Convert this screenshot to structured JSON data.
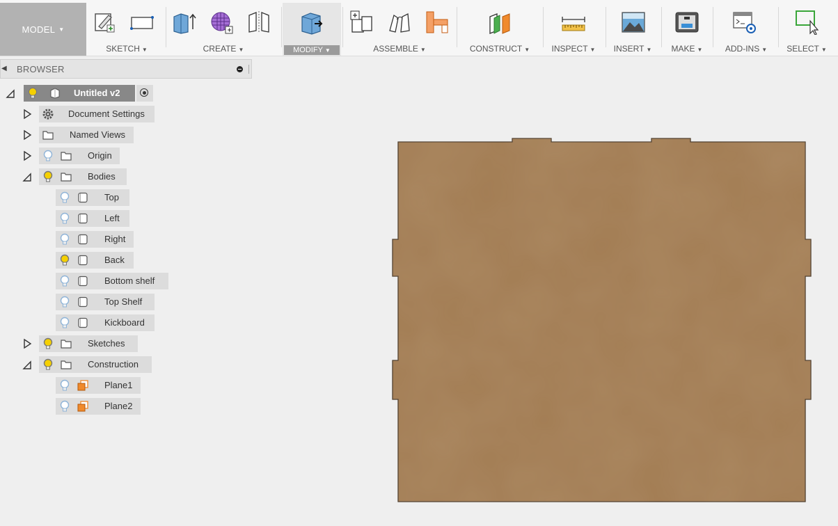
{
  "toolbar": {
    "model_label": "MODEL",
    "groups": [
      {
        "label": "SKETCH"
      },
      {
        "label": "CREATE"
      },
      {
        "label": "MODIFY"
      },
      {
        "label": "ASSEMBLE"
      },
      {
        "label": "CONSTRUCT"
      },
      {
        "label": "INSPECT"
      },
      {
        "label": "INSERT"
      },
      {
        "label": "MAKE"
      },
      {
        "label": "ADD-INS"
      },
      {
        "label": "SELECT"
      }
    ],
    "active_group": "MODIFY"
  },
  "browser": {
    "title": "BROWSER",
    "root": {
      "label": "Untitled v2"
    },
    "items": [
      {
        "label": "Document Settings",
        "type": "gear-icon",
        "expander": "collapsed"
      },
      {
        "label": "Named Views",
        "type": "folder-icon",
        "expander": "collapsed"
      },
      {
        "label": "Origin",
        "type": "folder-icon",
        "expander": "collapsed"
      },
      {
        "label": "Bodies",
        "type": "folder-icon",
        "expander": "expanded"
      },
      {
        "label": "Top",
        "type": "body-icon"
      },
      {
        "label": "Left",
        "type": "body-icon"
      },
      {
        "label": "Right",
        "type": "body-icon"
      },
      {
        "label": "Back",
        "type": "body-icon"
      },
      {
        "label": "Bottom shelf",
        "type": "body-icon"
      },
      {
        "label": "Top Shelf",
        "type": "body-icon"
      },
      {
        "label": "Kickboard",
        "type": "body-icon"
      },
      {
        "label": "Sketches",
        "type": "folder-icon",
        "expander": "collapsed"
      },
      {
        "label": "Construction",
        "type": "folder-icon",
        "expander": "expanded"
      },
      {
        "label": "Plane1",
        "type": "plane-icon"
      },
      {
        "label": "Plane2",
        "type": "plane-icon"
      }
    ]
  },
  "colors": {
    "panel_fill": "#a27c53",
    "bulb_on": "#f5d000",
    "bulb_off": "#8fb4d8",
    "plane": "#f08a2c",
    "select_icon": "#3aa63a"
  }
}
